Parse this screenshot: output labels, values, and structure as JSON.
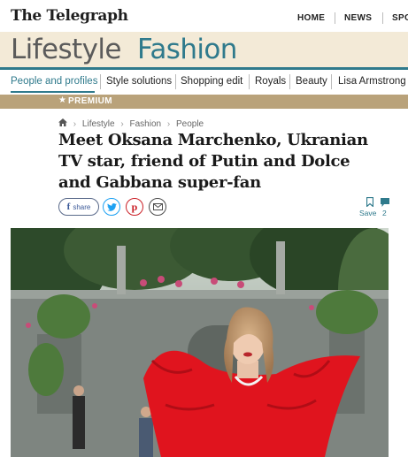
{
  "header": {
    "logo": "The Telegraph",
    "nav": [
      "HOME",
      "NEWS",
      "SPO"
    ]
  },
  "section": {
    "primary": "Lifestyle",
    "secondary": "Fashion",
    "accent_color": "#2f7a8c",
    "band_color": "#f3ead7"
  },
  "subnav": {
    "items": [
      "People and profiles",
      "Style solutions",
      "Shopping edit",
      "Royals",
      "Beauty",
      "Lisa Armstrong"
    ],
    "active_index": 0
  },
  "premium": {
    "icon": "star-icon",
    "label": "PREMIUM",
    "color": "#b9a27a"
  },
  "breadcrumb": {
    "home_icon": "home-icon",
    "items": [
      "Lifestyle",
      "Fashion",
      "People"
    ]
  },
  "article": {
    "headline": "Meet Oksana Marchenko, Ukranian TV star, friend of Putin and Dolce and Gabbana super-fan"
  },
  "share": {
    "facebook_label": "share",
    "icons": [
      "facebook-icon",
      "twitter-icon",
      "pinterest-icon",
      "email-icon"
    ]
  },
  "actions": {
    "save_label": "Save",
    "comment_count": "2"
  },
  "photo": {
    "subject": "woman-in-red-feather-dress"
  }
}
